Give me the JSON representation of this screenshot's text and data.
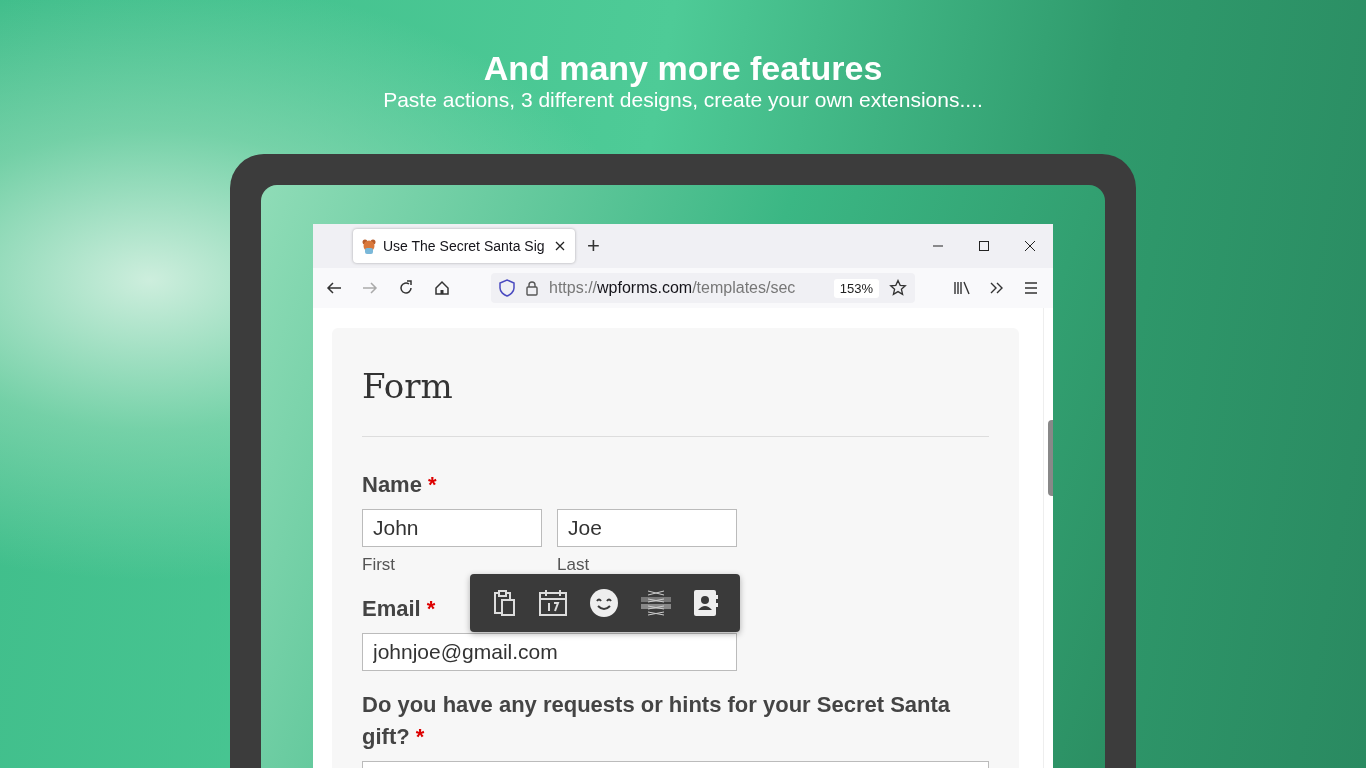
{
  "banner": {
    "title": "And many more features",
    "subtitle": "Paste actions, 3 different designs, create your own extensions...."
  },
  "browser": {
    "tabs": [
      {
        "title": "Use The Secret Santa Sig",
        "selected": true
      }
    ],
    "new_tab": "+",
    "url": {
      "scheme": "https://",
      "host": "wpforms.com",
      "path": "/templates/sec"
    },
    "zoom": "153%"
  },
  "form": {
    "title": "Form",
    "fields": [
      {
        "kind": "name",
        "label": "Name",
        "required_mark": "*",
        "inputs": [
          {
            "value": "John",
            "sublabel": "First"
          },
          {
            "value": "Joe",
            "sublabel": "Last"
          }
        ]
      },
      {
        "kind": "text",
        "label": "Email",
        "required_mark": "*",
        "value": "johnjoe@gmail.com"
      },
      {
        "kind": "textarea",
        "label": "Do you have any requests or hints for your Secret Santa gift?",
        "required_mark": "*"
      }
    ]
  }
}
